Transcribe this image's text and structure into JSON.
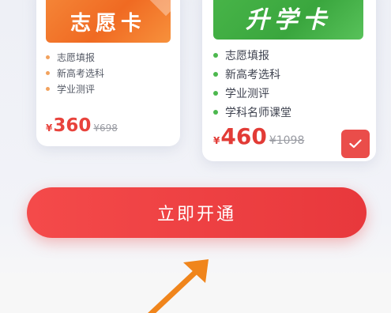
{
  "cards": [
    {
      "title": "志愿卡",
      "features": [
        "志愿填报",
        "新高考选科",
        "学业测评"
      ],
      "currency": "¥",
      "price": "360",
      "original_price": "¥698",
      "accent": "#f06a22"
    },
    {
      "title": "升学卡",
      "features": [
        "志愿填报",
        "新高考选科",
        "学业测评",
        "学科名师课堂"
      ],
      "currency": "¥",
      "price": "460",
      "original_price": "¥1098",
      "accent": "#3aa63e",
      "selected": true,
      "selected_icon": "check-icon"
    }
  ],
  "cta": {
    "label": "立即开通",
    "color": "#ee4142"
  },
  "pointer": {
    "icon": "arrow-pointer-icon",
    "color": "#f0851c"
  }
}
